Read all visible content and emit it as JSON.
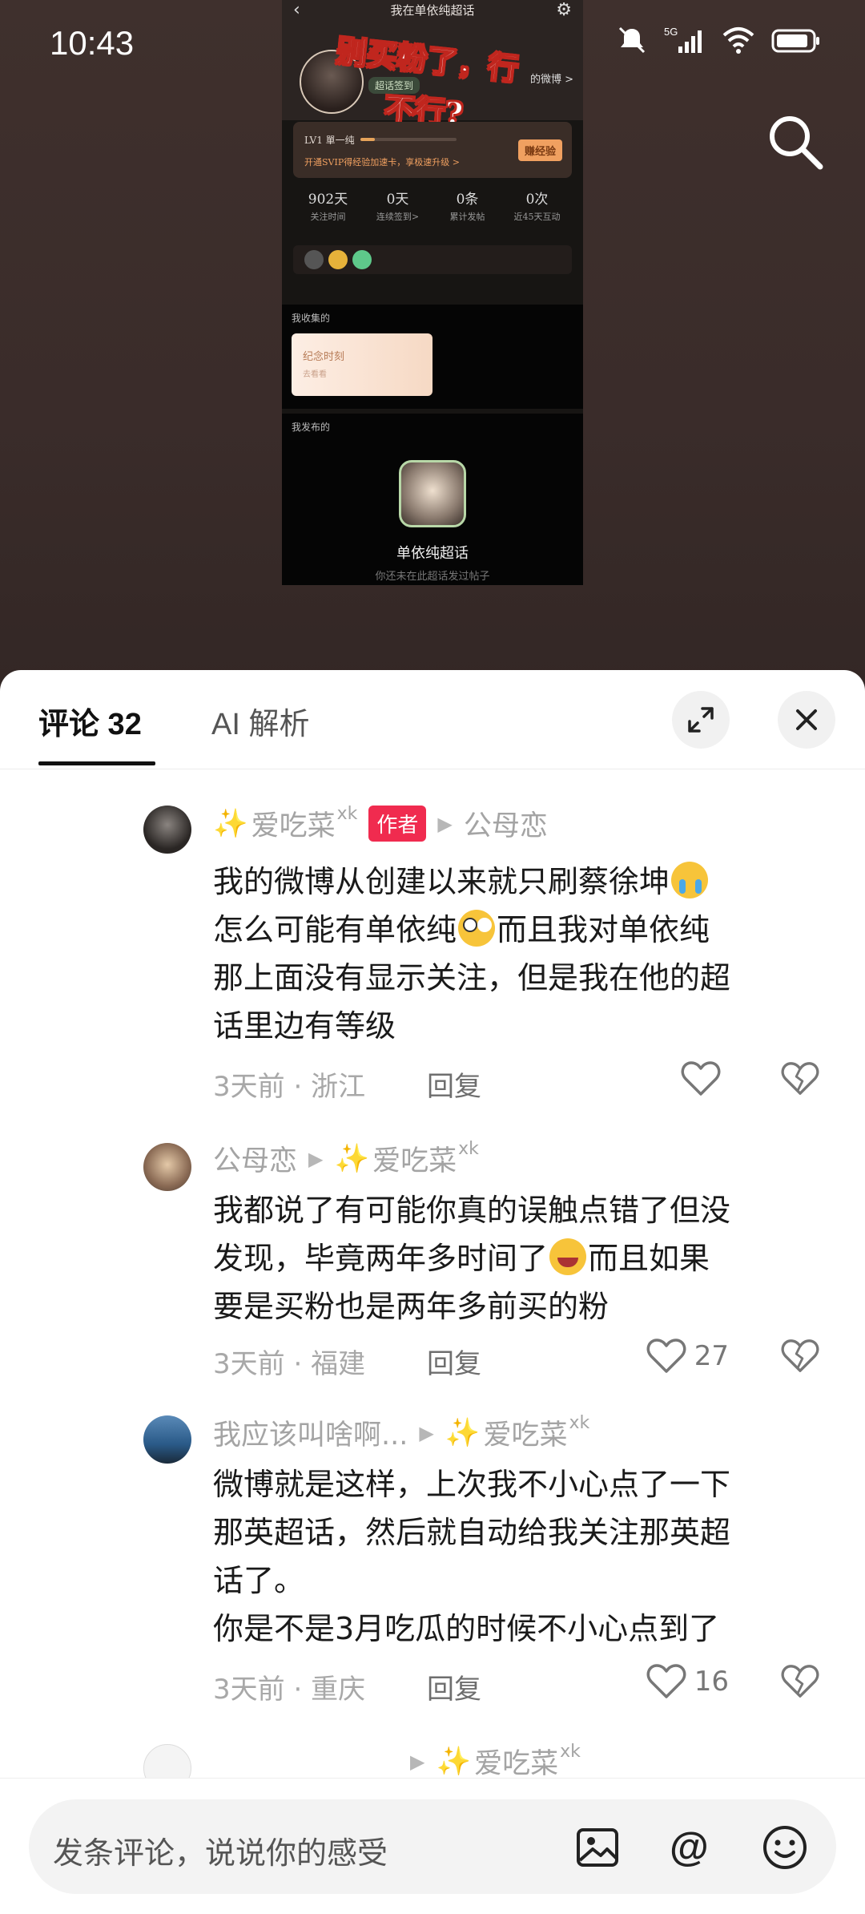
{
  "status_bar": {
    "time": "10:43"
  },
  "inner_screenshot": {
    "title": "我在单依纯超话",
    "tag": "超话签到",
    "weibo_link": "的微博 >",
    "overlay_line1": "别买粉了，行",
    "overlay_line2": "不行?",
    "level_label": "LV1 單一纯",
    "level_tip": "开通SVIP得经验加速卡，享极速升级 >",
    "level_button": "赚经验",
    "level_progress": 0.15,
    "stats": [
      {
        "value": "902天",
        "label": "关注时间"
      },
      {
        "value": "0天",
        "label": "连续签到>"
      },
      {
        "value": "0条",
        "label": "累计发帖"
      },
      {
        "value": "0次",
        "label": "近45天互动"
      }
    ],
    "section1_title": "我收集的",
    "fav_card_title": "纪念时刻",
    "fav_card_sub": "去看看",
    "section2_title": "我发布的",
    "channel_name": "单依纯超话",
    "channel_sub": "你还未在此超话发过帖子"
  },
  "sheet": {
    "tab_comments": "评论 32",
    "tab_ai": "AI 解析",
    "close_icon": "close-icon",
    "expand_icon": "expand-icon"
  },
  "comments": [
    {
      "username": "爱吃菜",
      "username_sup": "xk",
      "author_tag": "作者",
      "reply_to": "公母恋",
      "text_line1": "我的微博从创建以来就只刷蔡徐坤",
      "text_line2a": "怎么可能有单依纯",
      "text_line2b": "而且我对单依纯",
      "text_line3": "那上面没有显示关注，但是我在他的超",
      "text_line4": "话里边有等级",
      "time": "3天前",
      "location": "浙江",
      "reply": "回复",
      "likes": ""
    },
    {
      "username": "公母恋",
      "reply_to": "爱吃菜",
      "reply_to_sup": "xk",
      "text_line1": "我都说了有可能你真的误触点错了但没",
      "text_line2a": "发现，毕竟两年多时间了",
      "text_line2b": "而且如果",
      "text_line3": "要是买粉也是两年多前买的粉",
      "time": "3天前",
      "location": "福建",
      "reply": "回复",
      "likes": "27"
    },
    {
      "username": "我应该叫啥啊...",
      "reply_to": "爱吃菜",
      "reply_to_sup": "xk",
      "text_line1": "微博就是这样，上次我不小心点了一下",
      "text_line2": "那英超话，然后就自动给我关注那英超",
      "text_line3": "话了。",
      "text_line4": "你是不是3月吃瓜的时候不小心点到了",
      "time": "3天前",
      "location": "重庆",
      "reply": "回复",
      "likes": "16"
    },
    {
      "reply_to": "爱吃菜",
      "reply_to_sup": "xk"
    }
  ],
  "input": {
    "placeholder": "发条评论，说说你的感受"
  },
  "colors": {
    "author_tag": "#f02b4f",
    "sheet_bg": "#ffffff",
    "top_bg": "#3a2e2c"
  }
}
